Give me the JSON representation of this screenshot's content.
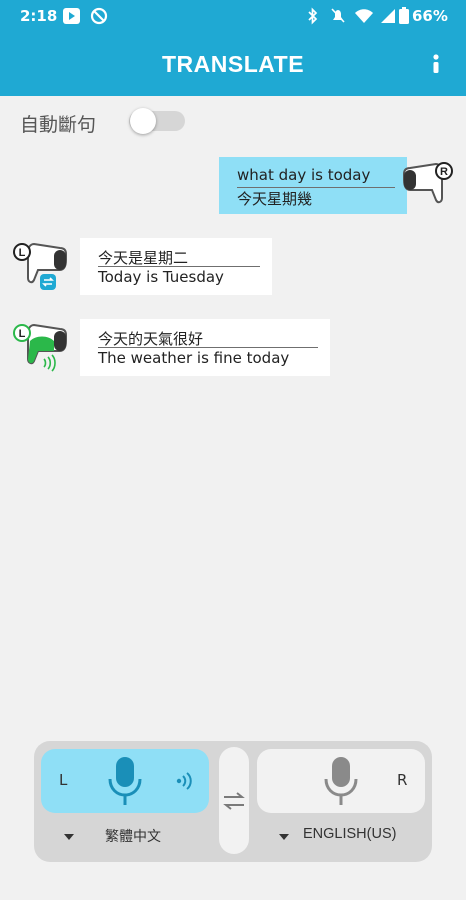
{
  "status_bar": {
    "time": "2:18",
    "battery": "66%"
  },
  "app_bar": {
    "title": "TRANSLATE"
  },
  "auto_segment": {
    "label": "自動斷句",
    "enabled": false
  },
  "messages": [
    {
      "side": "right",
      "speaker": "R",
      "source": "what day is today",
      "translation": "今天星期幾"
    },
    {
      "side": "left",
      "speaker": "L",
      "source": "今天是星期二",
      "translation": "Today is Tuesday"
    },
    {
      "side": "left",
      "speaker": "L",
      "source": "今天的天氣很好",
      "translation": "The weather is fine today"
    }
  ],
  "controls": {
    "left": {
      "side": "L",
      "language": "繁體中文",
      "active": true
    },
    "right": {
      "side": "R",
      "language": "ENGLISH(US)",
      "active": false
    }
  },
  "colors": {
    "primary": "#1fa9d3",
    "bubble_light_blue": "#8fdff6",
    "green": "#2bb84a"
  }
}
